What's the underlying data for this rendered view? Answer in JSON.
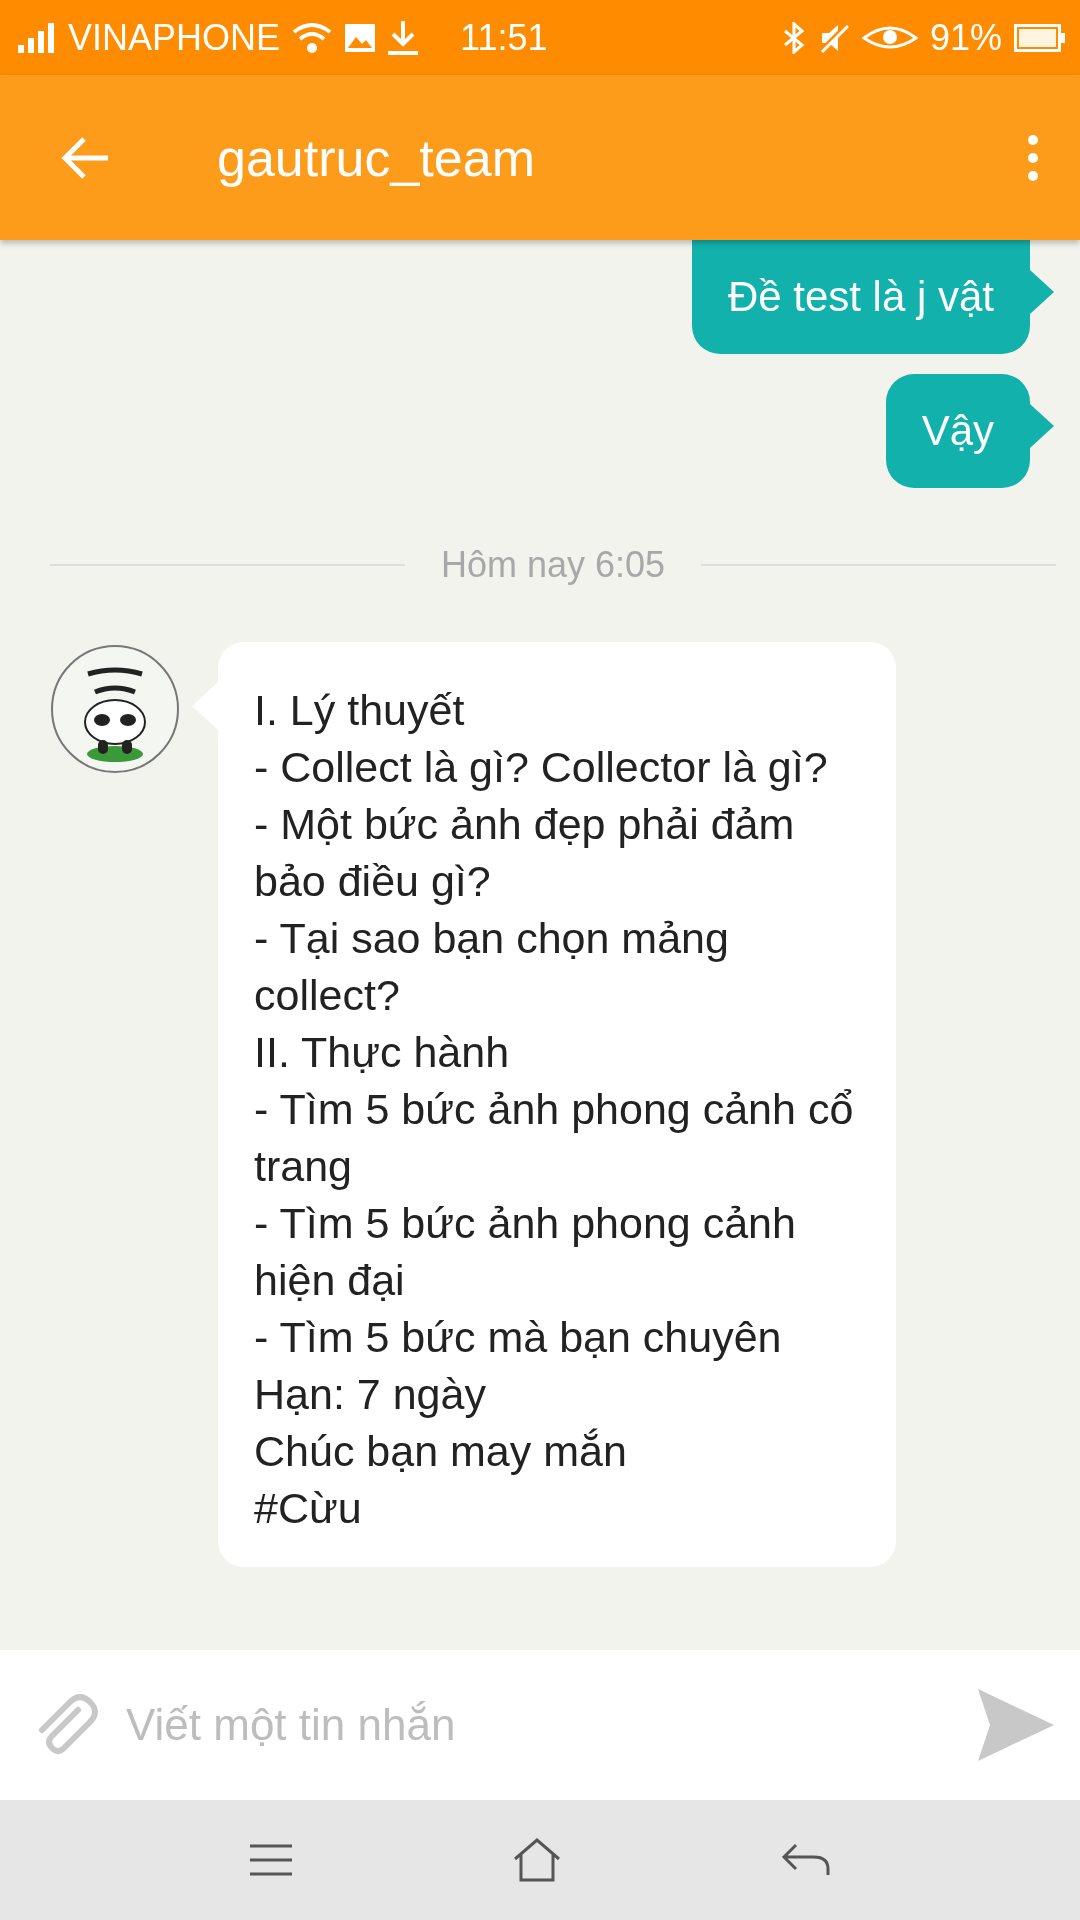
{
  "status_bar": {
    "carrier": "VINAPHONE",
    "time": "11:51",
    "battery": "91%"
  },
  "app_bar": {
    "title": "gautruc_team"
  },
  "messages": [
    {
      "kind": "outgoing",
      "text": "Đề test là j vật"
    },
    {
      "kind": "outgoing",
      "text": "Vậy"
    },
    {
      "kind": "divider",
      "text": "Hôm nay 6:05"
    },
    {
      "kind": "incoming",
      "text": "I. Lý thuyết\n- Collect là gì? Collector là gì?\n- Một bức ảnh đẹp phải đảm bảo điều gì?\n- Tại sao bạn chọn mảng collect?\nII. Thực hành\n- Tìm 5 bức ảnh phong cảnh cổ trang\n- Tìm 5 bức ảnh phong cảnh hiện đại\n- Tìm 5 bức mà bạn chuyên\nHạn: 7 ngày\nChúc bạn may mắn\n#Cừu"
    }
  ],
  "composer": {
    "placeholder": "Viết một tin nhắn"
  }
}
